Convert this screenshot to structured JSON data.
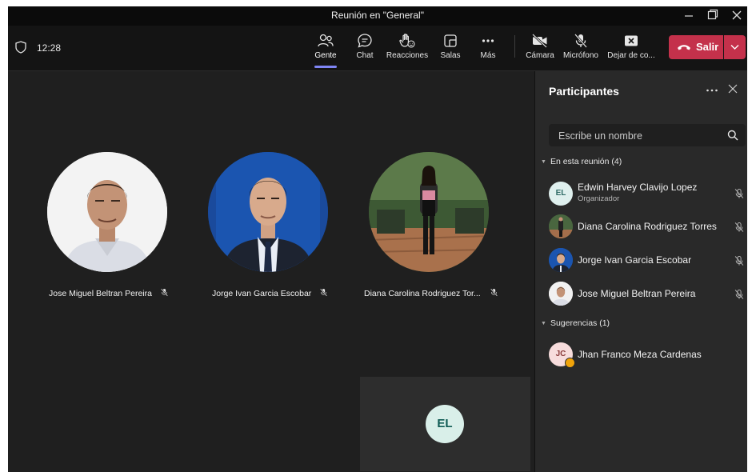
{
  "window": {
    "title": "Reunión en \"General\""
  },
  "toolbar": {
    "time": "12:28",
    "buttons": [
      {
        "label": "Gente",
        "icon": "people-icon"
      },
      {
        "label": "Chat",
        "icon": "chat-icon"
      },
      {
        "label": "Reacciones",
        "icon": "raise-hand-icon"
      },
      {
        "label": "Salas",
        "icon": "rooms-icon"
      },
      {
        "label": "Más",
        "icon": "more-icon"
      },
      {
        "label": "Cámara",
        "icon": "camera-off-icon"
      },
      {
        "label": "Micrófono",
        "icon": "mic-off-icon"
      },
      {
        "label": "Dejar de co...",
        "icon": "stop-share-icon"
      }
    ],
    "leave_label": "Salir"
  },
  "stage": {
    "participants": [
      {
        "name": "Jose Miguel Beltran Pereira"
      },
      {
        "name": "Jorge Ivan Garcia Escobar"
      },
      {
        "name": "Diana Carolina Rodriguez Tor..."
      }
    ],
    "self_initials": "EL"
  },
  "panel": {
    "title": "Participantes",
    "search_placeholder": "Escribe un nombre",
    "in_meeting_label": "En esta reunión (4)",
    "members": [
      {
        "name": "Edwin Harvey Clavijo Lopez",
        "role": "Organizador",
        "initials": "EL"
      },
      {
        "name": "Diana Carolina Rodriguez Torres"
      },
      {
        "name": "Jorge Ivan Garcia Escobar"
      },
      {
        "name": "Jose Miguel Beltran Pereira"
      }
    ],
    "suggestions_label": "Sugerencias (1)",
    "suggestions": [
      {
        "name": "Jhan Franco Meza Cardenas",
        "initials": "JC"
      }
    ]
  },
  "colors": {
    "accent": "#7f85f5",
    "leave": "#c4314b",
    "background": "#1f1f1f",
    "panel": "#292929"
  }
}
